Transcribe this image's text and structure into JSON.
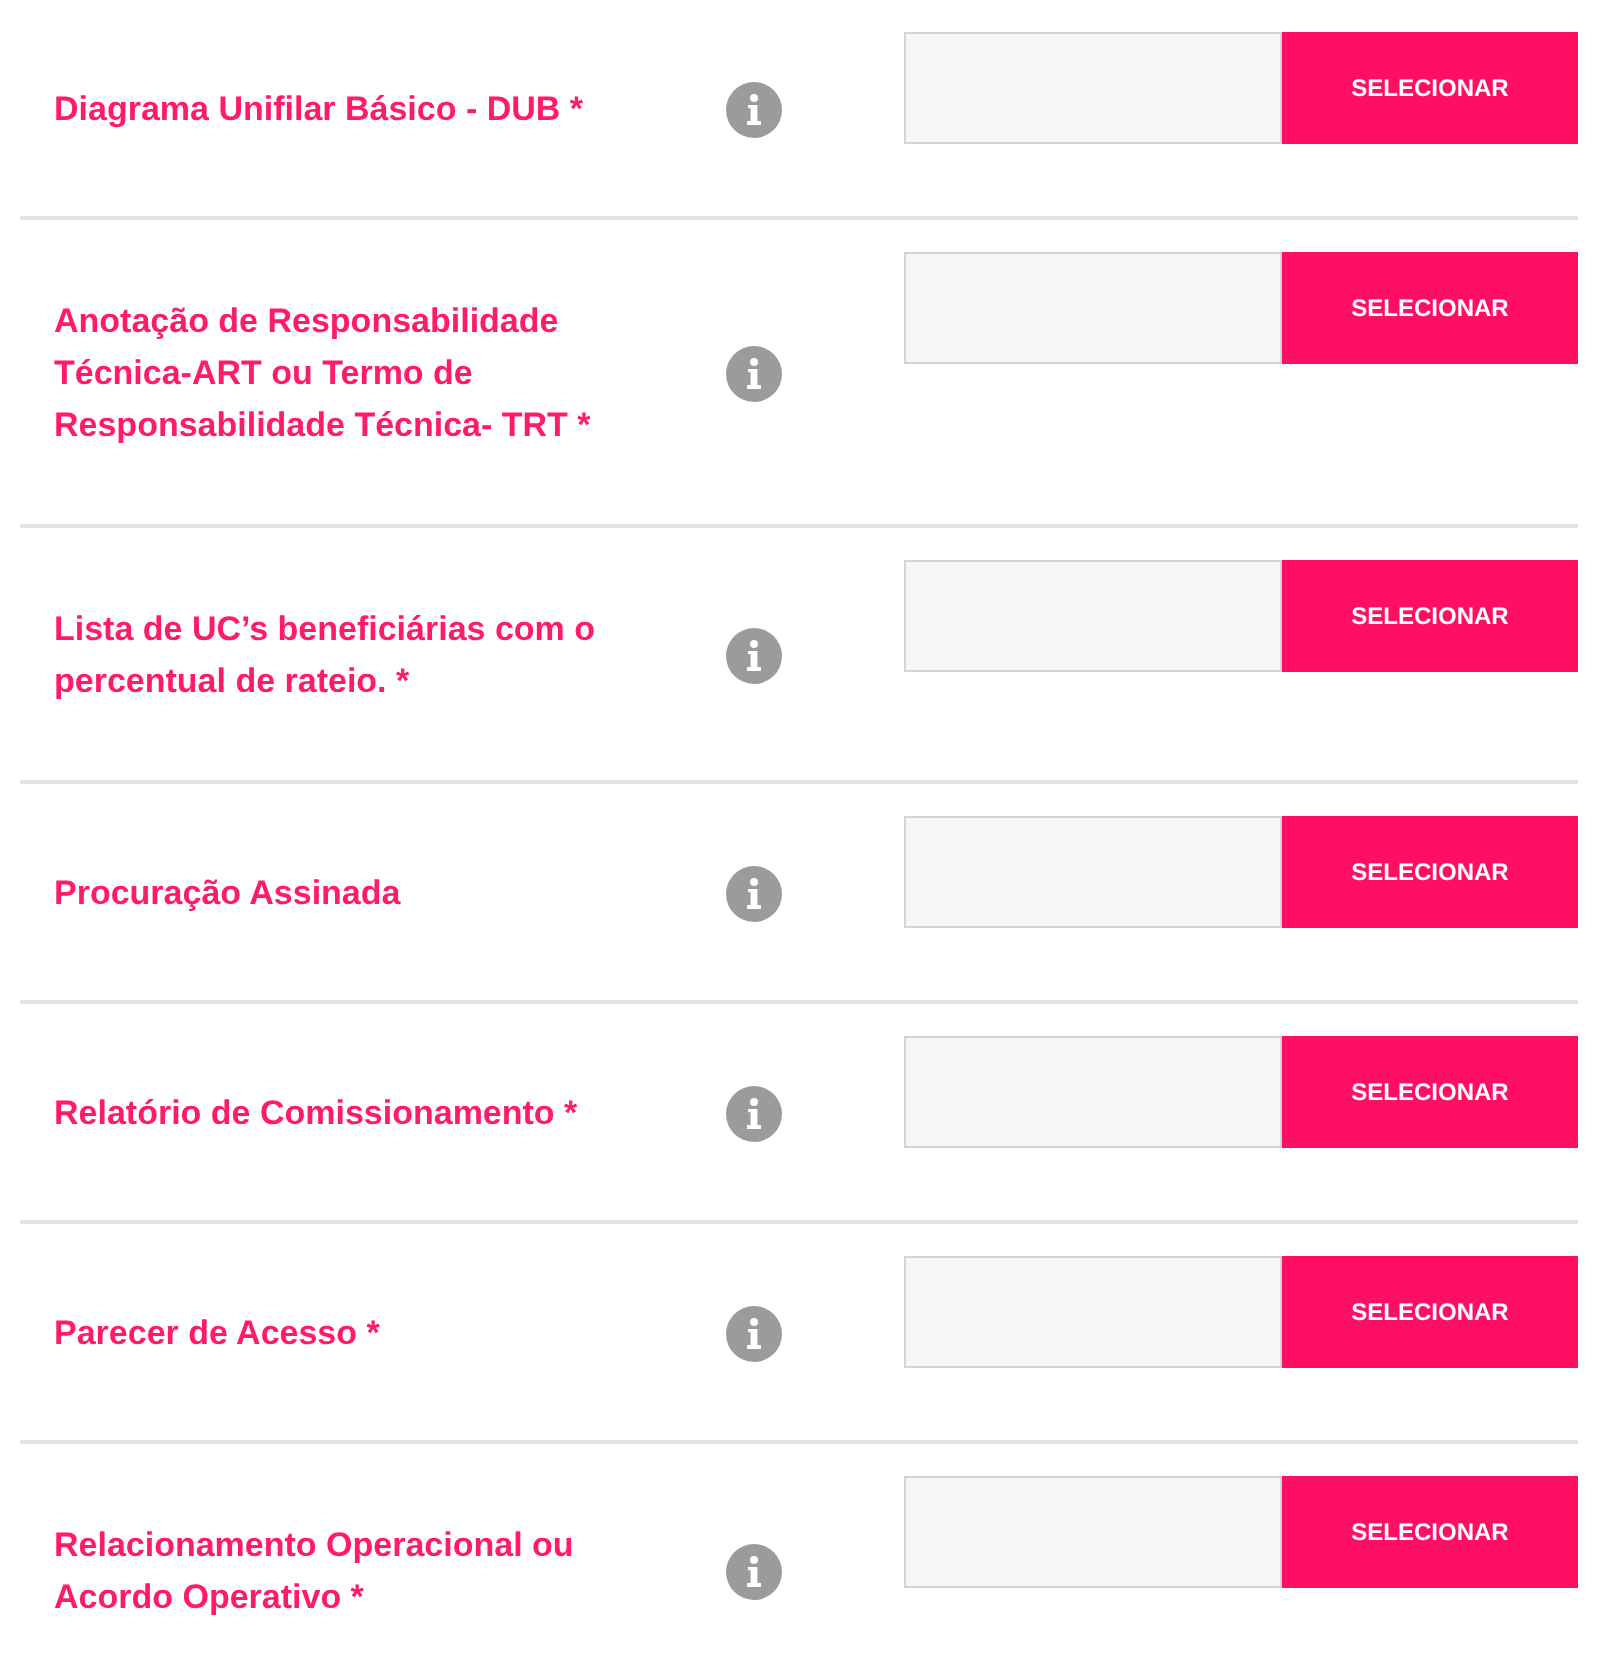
{
  "documents": [
    {
      "label": "Diagrama Unifilar Básico - DUB *",
      "button": "SELECIONAR"
    },
    {
      "label": "Anotação de Responsabilidade Técnica-ART ou Termo de Responsabilidade Técnica- TRT *",
      "button": "SELECIONAR"
    },
    {
      "label": "Lista de UC’s beneficiárias com o percentual de rateio. *",
      "button": "SELECIONAR"
    },
    {
      "label": "Procuração Assinada",
      "button": "SELECIONAR"
    },
    {
      "label": "Relatório de Comissionamento *",
      "button": "SELECIONAR"
    },
    {
      "label": "Parecer de Acesso *",
      "button": "SELECIONAR"
    },
    {
      "label": "Relacionamento Operacional ou Acordo Operativo *",
      "button": "SELECIONAR"
    }
  ]
}
